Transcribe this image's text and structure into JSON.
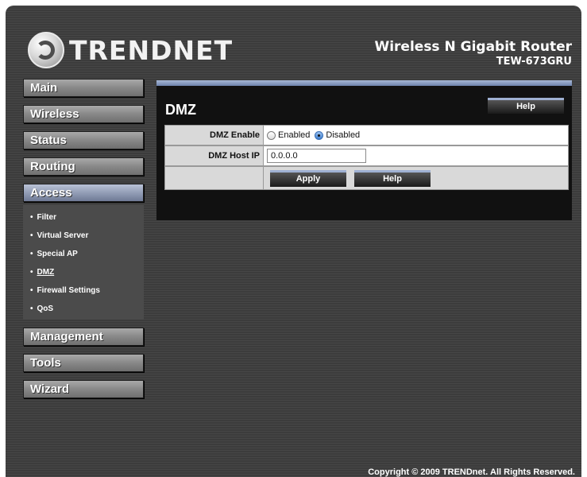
{
  "header": {
    "brand": "TRENDNET",
    "product_name": "Wireless N Gigabit Router",
    "model": "TEW-673GRU"
  },
  "sidebar": {
    "items": [
      {
        "label": "Main"
      },
      {
        "label": "Wireless"
      },
      {
        "label": "Status"
      },
      {
        "label": "Routing"
      },
      {
        "label": "Access",
        "active": true
      },
      {
        "label": "Management"
      },
      {
        "label": "Tools"
      },
      {
        "label": "Wizard"
      }
    ],
    "access_submenu": [
      {
        "label": "Filter"
      },
      {
        "label": "Virtual Server"
      },
      {
        "label": "Special AP"
      },
      {
        "label": "DMZ",
        "current": true
      },
      {
        "label": "Firewall Settings"
      },
      {
        "label": "QoS"
      }
    ],
    "bullet": "•"
  },
  "main": {
    "title": "DMZ",
    "help_label": "Help",
    "form": {
      "dmz_enable_label": "DMZ Enable",
      "enabled_option": "Enabled",
      "disabled_option": "Disabled",
      "selected": "Disabled",
      "host_ip_label": "DMZ Host IP",
      "host_ip_value": "0.0.0.0"
    },
    "apply_label": "Apply",
    "help_button_label": "Help"
  },
  "footer": {
    "copyright": "Copyright © 2009 TRENDnet. All Rights Reserved."
  },
  "colors": {
    "background": "#3c3c3c",
    "panel": "#111111",
    "accent": "#9fb0d2",
    "active_nav": "#8f9ab3"
  }
}
